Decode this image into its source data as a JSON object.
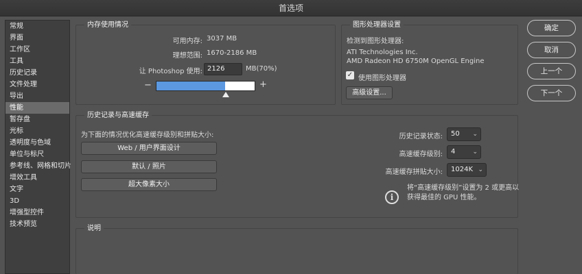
{
  "window": {
    "title": "首选项"
  },
  "sidebar": {
    "items": [
      {
        "label": "常规"
      },
      {
        "label": "界面"
      },
      {
        "label": "工作区"
      },
      {
        "label": "工具"
      },
      {
        "label": "历史记录"
      },
      {
        "label": "文件处理"
      },
      {
        "label": "导出"
      },
      {
        "label": "性能",
        "selected": true
      },
      {
        "label": "暂存盘"
      },
      {
        "label": "光标"
      },
      {
        "label": "透明度与色域"
      },
      {
        "label": "单位与标尺"
      },
      {
        "label": "参考线、网格和切片"
      },
      {
        "label": "增效工具"
      },
      {
        "label": "文字"
      },
      {
        "label": "3D"
      },
      {
        "label": "增强型控件"
      },
      {
        "label": "技术预览"
      }
    ]
  },
  "memory": {
    "title": "内存使用情况",
    "available_label": "可用内存:",
    "available_value": "3037 MB",
    "ideal_label": "理想范围:",
    "ideal_value": "1670-2186 MB",
    "let_label": "让 Photoshop 使用:",
    "let_value": "2126",
    "let_unit": "MB(70%)",
    "minus": "−",
    "plus": "+",
    "usage_fraction": 0.7
  },
  "gpu": {
    "title": "图形处理器设置",
    "detected_label": "检测到图形处理器:",
    "vendor": "ATI Technologies Inc.",
    "model": "AMD Radeon HD 6750M OpenGL Engine",
    "use_gpu_label": "使用图形处理器",
    "use_gpu_checked": true,
    "advanced_button": "高级设置..."
  },
  "history": {
    "title": "历史记录与高速缓存",
    "optimize_label": "为下面的情况优化高速缓存级别和拼贴大小:",
    "presets": [
      "Web / 用户界面设计",
      "默认 / 照片",
      "超大像素大小"
    ],
    "states_label": "历史记录状态:",
    "states_value": "50",
    "levels_label": "高速缓存级别:",
    "levels_value": "4",
    "tile_label": "高速缓存拼贴大小:",
    "tile_value": "1024K",
    "hint_line1": "将“高速缓存级别”设置为 2 或更高以",
    "hint_line2": "获得最佳的 GPU 性能。",
    "info_icon": "i"
  },
  "description": {
    "title": "说明"
  },
  "buttons": {
    "ok": "确定",
    "cancel": "取消",
    "prev": "上一个",
    "next": "下一个"
  }
}
